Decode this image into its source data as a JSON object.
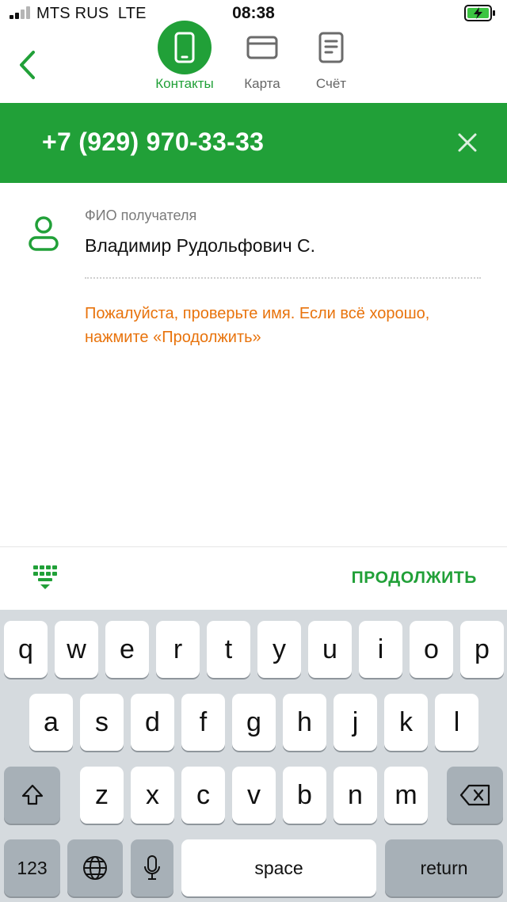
{
  "status_bar": {
    "carrier": "MTS RUS",
    "network": "LTE",
    "time": "08:38"
  },
  "nav": {
    "tabs": [
      {
        "label": "Контакты",
        "icon": "smartphone-icon",
        "active": true
      },
      {
        "label": "Карта",
        "icon": "card-icon",
        "active": false
      },
      {
        "label": "Счёт",
        "icon": "document-icon",
        "active": false
      }
    ]
  },
  "banner": {
    "phone": "+7 (929) 970-33-33"
  },
  "recipient": {
    "label": "ФИО получателя",
    "name": "Владимир Рудольфович С.",
    "warning": "Пожалуйста, проверьте имя. Если всё хорошо, нажмите «Продолжить»"
  },
  "action_bar": {
    "continue_label": "ПРОДОЛЖИТЬ"
  },
  "keyboard": {
    "row1": [
      "q",
      "w",
      "e",
      "r",
      "t",
      "y",
      "u",
      "i",
      "o",
      "p"
    ],
    "row2": [
      "a",
      "s",
      "d",
      "f",
      "g",
      "h",
      "j",
      "k",
      "l"
    ],
    "row3": [
      "z",
      "x",
      "c",
      "v",
      "b",
      "n",
      "m"
    ],
    "numbers_label": "123",
    "space_label": "space",
    "return_label": "return"
  },
  "colors": {
    "brand_green": "#21a038",
    "warning_orange": "#e8730c"
  }
}
